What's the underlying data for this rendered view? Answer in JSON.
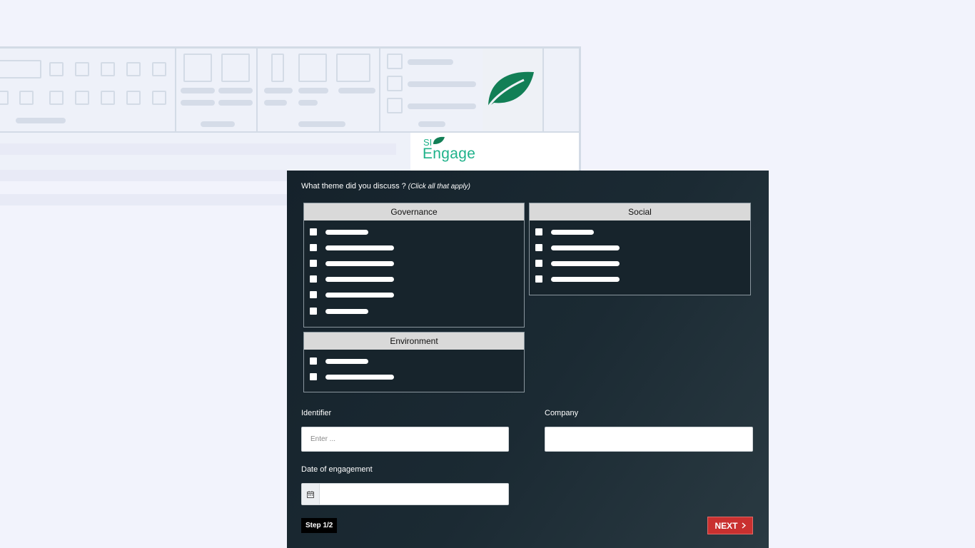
{
  "brand": {
    "logo_small": "SI",
    "logo_name": "Engage",
    "leaf_color": "#127f56",
    "accent_teal": "#1fb28a"
  },
  "form": {
    "question": "What theme did you discuss ?",
    "question_hint": "(Click all that apply)",
    "groups": [
      {
        "title": "Governance",
        "option_count": 6
      },
      {
        "title": "Social",
        "option_count": 4
      },
      {
        "title": "Environment",
        "option_count": 2
      }
    ],
    "identifier_label": "Identifier",
    "identifier_placeholder": "Enter ...",
    "company_label": "Company",
    "date_label": "Date of engagement",
    "step": "Step 1/2",
    "next": "NEXT"
  },
  "icons": {
    "calendar": "calendar-icon",
    "next": "chevron-right-icon",
    "leaf": "leaf-icon"
  },
  "colors": {
    "dialog_bg": "#1b2a33",
    "next_button": "#c9302f",
    "group_header": "#d9d9d9"
  }
}
